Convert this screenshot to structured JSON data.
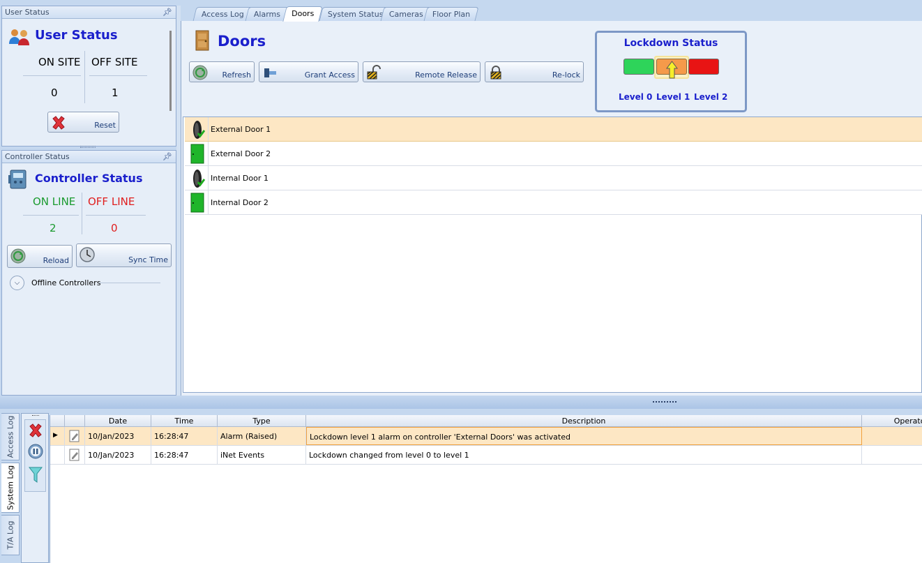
{
  "user_status": {
    "panel_title": "User Status",
    "heading": "User Status",
    "on_site_label": "ON SITE",
    "off_site_label": "OFF SITE",
    "on_site_count": "0",
    "off_site_count": "1",
    "reset_label": "Reset"
  },
  "controller_status": {
    "panel_title": "Controller Status",
    "heading": "Controller Status",
    "on_line_label": "ON LINE",
    "off_line_label": "OFF LINE",
    "on_line_count": "2",
    "off_line_count": "0",
    "reload_label": "Reload",
    "sync_label": "Sync Time",
    "offline_controllers_label": "Offline Controllers"
  },
  "tabs": [
    {
      "label": "Access Log"
    },
    {
      "label": "Alarms"
    },
    {
      "label": "Doors"
    },
    {
      "label": "System Status"
    },
    {
      "label": "Cameras"
    },
    {
      "label": "Floor Plan"
    }
  ],
  "doors": {
    "heading": "Doors",
    "toolbar": {
      "refresh": "Refresh",
      "grant_access": "Grant Access",
      "remote_release": "Remote Release",
      "relock": "Re-lock"
    },
    "items": [
      {
        "name": "External Door 1",
        "icon": "door-locked-icon"
      },
      {
        "name": "External Door 2",
        "icon": "door-open-icon"
      },
      {
        "name": "Internal Door 1",
        "icon": "door-locked-icon"
      },
      {
        "name": "Internal Door 2",
        "icon": "door-open-icon"
      }
    ]
  },
  "lockdown": {
    "title": "Lockdown Status",
    "levels": [
      {
        "label": "Level 0",
        "color": "#2ed45a"
      },
      {
        "label": "Level 1",
        "color": "#f59a4a"
      },
      {
        "label": "Level 2",
        "color": "#e81414"
      }
    ],
    "current_level": 1
  },
  "log": {
    "side_tabs": [
      {
        "label": "Access Log"
      },
      {
        "label": "System Log"
      },
      {
        "label": "T/A Log"
      }
    ],
    "columns": [
      "Date",
      "Time",
      "Type",
      "Description",
      "Operator"
    ],
    "rows": [
      {
        "date": "10/Jan/2023",
        "time": "16:28:47",
        "type": "Alarm (Raised)",
        "description": "Lockdown level 1 alarm on controller 'External Doors' was activated",
        "operator": ""
      },
      {
        "date": "10/Jan/2023",
        "time": "16:28:47",
        "type": "iNet Events",
        "description": "Lockdown changed from level 0 to level 1",
        "operator": ""
      }
    ]
  },
  "colors": {
    "heading_blue": "#1a1fcc",
    "online_green": "#1a9a2e",
    "offline_red": "#e01e1e",
    "selected_row": "#fde7c4"
  }
}
